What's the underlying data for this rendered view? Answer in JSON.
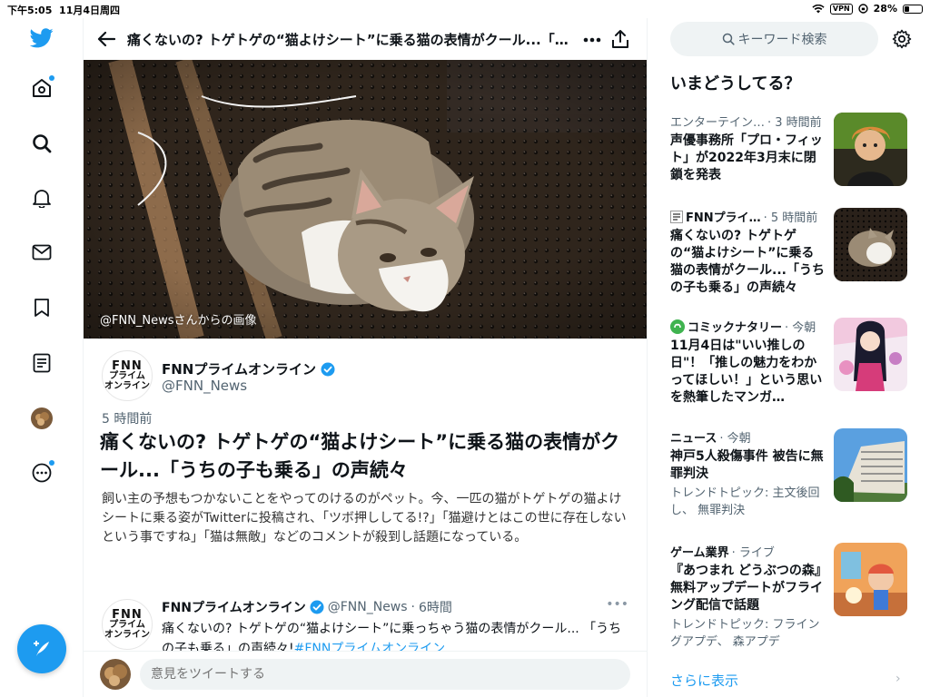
{
  "status_bar": {
    "time": "下午5:05",
    "date": "11月4日周四",
    "vpn": "VPN",
    "battery": "28%",
    "battery_level": 0.28
  },
  "header": {
    "title": "痛くないの? トゲトゲの“猫よけシート”に乗る猫の表情がクール...「…"
  },
  "hero": {
    "credit": "@FNN_Newsさんからの画像"
  },
  "article": {
    "logo_text": [
      "FNN",
      "プライム",
      "オンライン"
    ],
    "author_name": "FNNプライムオンライン",
    "author_handle": "@FNN_News",
    "time": "5 時間前",
    "headline": "痛くないの? トゲトゲの“猫よけシート”に乗る猫の表情がクール...「うちの子も乗る」の声続々",
    "description": "飼い主の予想もつかないことをやってのけるのがペット。今、一匹の猫がトゲトゲの猫よけシートに乗る姿がTwitterに投稿され、「ツボ押ししてる!?」「猫避けとはこの世に存在しないという事ですね」「猫は無敵」などのコメントが殺到し話題になっている。"
  },
  "tweet": {
    "name": "FNNプライムオンライン",
    "handle": "@FNN_News",
    "sep": "·",
    "time": "6時間",
    "text": "痛くないの? トゲトゲの“猫よけシート”に乗っちゃう猫の表情がクール... 「うちの子も乗る」の声続々!",
    "hashtag": "#FNNプライムオンライン"
  },
  "reply": {
    "placeholder": "意見をツイートする"
  },
  "sidebar": {
    "search_placeholder": "キーワード検索",
    "section_title": "いまどうしてる？",
    "trends": [
      {
        "source": "エンターテイン…",
        "time": "· 3 時間前",
        "title": "声優事務所「プロ・フィット」が2022年3月末に閉鎖を発表",
        "sub": ""
      },
      {
        "source": "FNNプライ…",
        "time": "· 5 時間前",
        "title": "痛くないの? トゲトゲの“猫よけシート”に乗る猫の表情がクール...「うちの子も乗る」の声続々",
        "sub": ""
      },
      {
        "source": "コミックナタリー",
        "time": "· 今朝",
        "title": "11月4日は\"いい推しの日\"！「推しの魅力をわかってほしい！」という思いを熱筆したマンガ…",
        "sub": ""
      },
      {
        "source": "ニュース",
        "time": "· 今朝",
        "title": "神戸5人殺傷事件 被告に無罪判決",
        "sub": "トレンドトピック: 主文後回し、 無罪判決"
      },
      {
        "source": "ゲーム業界",
        "time": "· ライブ",
        "title": "『あつまれ どうぶつの森』無料アップデートがフライング配信で話題",
        "sub": "トレンドトピック: フライングアプデ、 森アプデ"
      }
    ],
    "show_more": "さらに表示"
  },
  "colors": {
    "accent": "#1d9bf0",
    "text": "#0f1419",
    "muted": "#536471"
  }
}
